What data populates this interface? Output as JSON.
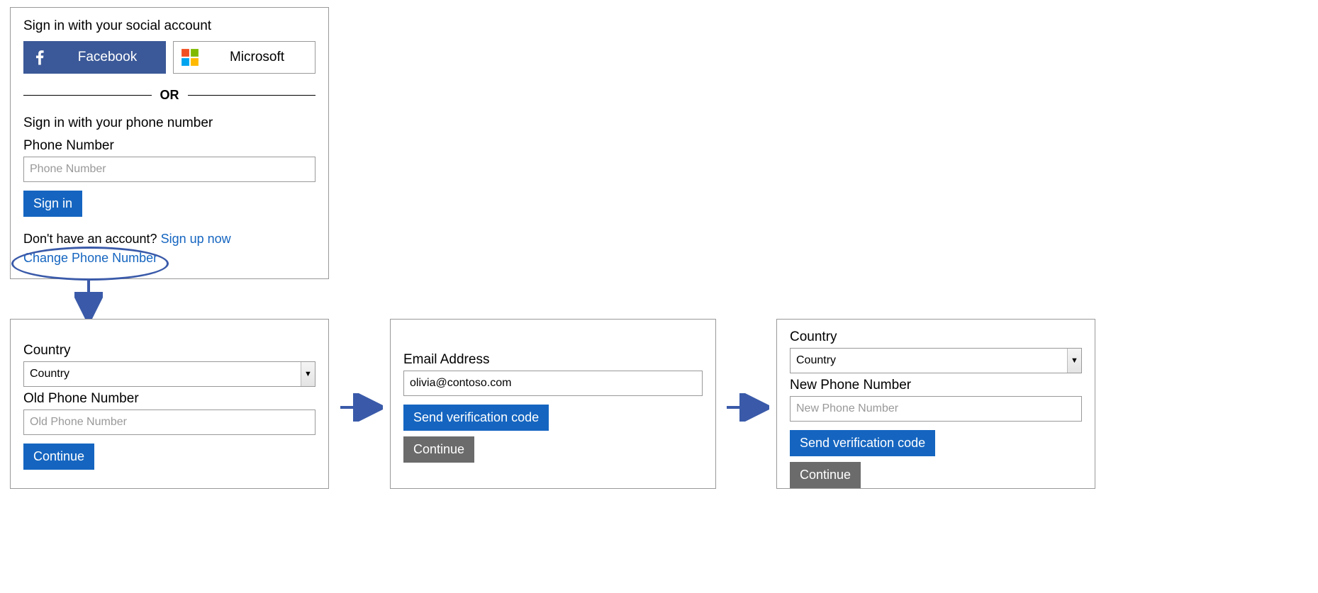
{
  "signin": {
    "socialHeading": "Sign in with your social account",
    "facebookLabel": "Facebook",
    "microsoftLabel": "Microsoft",
    "orLabel": "OR",
    "phoneHeading": "Sign in with your phone number",
    "phoneFieldLabel": "Phone Number",
    "phonePlaceholder": "Phone Number",
    "signInButton": "Sign in",
    "promptPrefix": "Don't have an account? ",
    "signupLink": "Sign up now",
    "changePhoneLink": "Change Phone Number"
  },
  "step1": {
    "countryLabel": "Country",
    "countryValue": "Country",
    "oldPhoneLabel": "Old Phone Number",
    "oldPhonePlaceholder": "Old Phone Number",
    "continueButton": "Continue"
  },
  "step2": {
    "emailLabel": "Email Address",
    "emailValue": "olivia@contoso.com",
    "sendCodeButton": "Send verification code",
    "continueButton": "Continue"
  },
  "step3": {
    "countryLabel": "Country",
    "countryValue": "Country",
    "newPhoneLabel": "New Phone Number",
    "newPhonePlaceholder": "New Phone Number",
    "sendCodeButton": "Send verification code",
    "continueButton": "Continue"
  }
}
